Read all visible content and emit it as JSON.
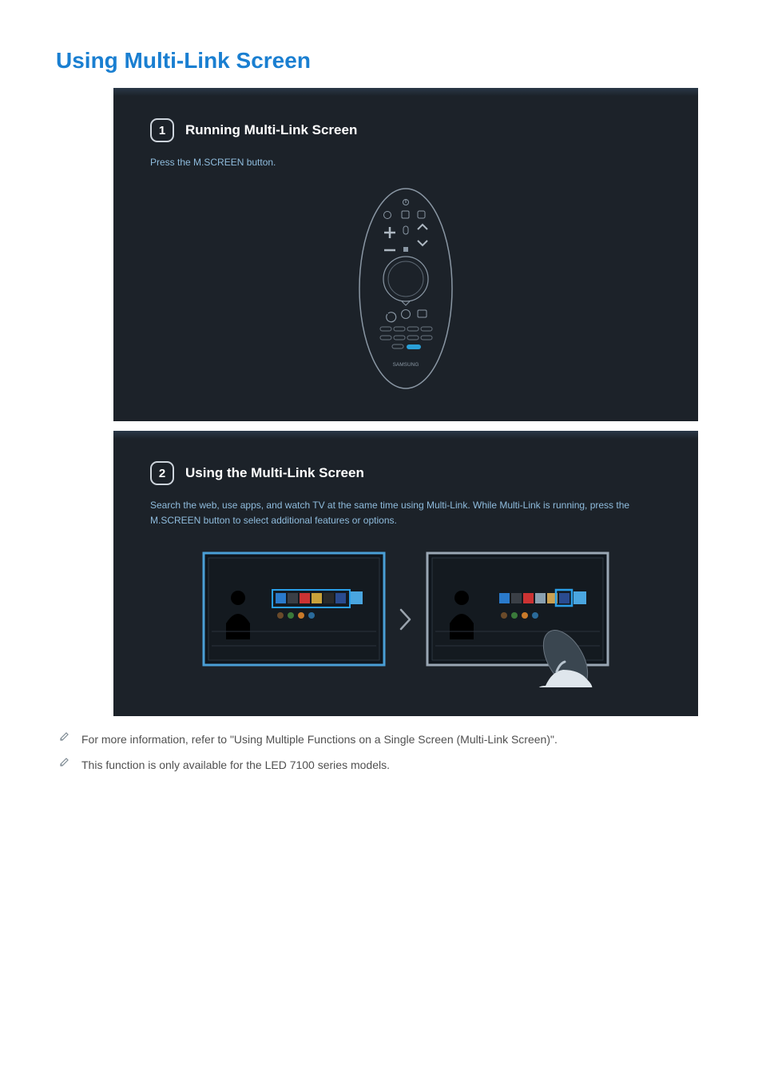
{
  "title": "Using Multi-Link Screen",
  "panel1": {
    "step_number": "1",
    "step_title": "Running Multi-Link Screen",
    "instruction": "Press the M.SCREEN button.",
    "remote_brand": "SAMSUNG"
  },
  "panel2": {
    "step_number": "2",
    "step_title": "Using the Multi-Link Screen",
    "instruction": "Search the web, use apps, and watch TV at the same time using Multi-Link. While Multi-Link is running, press the M.SCREEN button to select additional features or options."
  },
  "notes": {
    "n1": "For more information, refer to \"Using Multiple Functions on a Single Screen (Multi-Link Screen)\".",
    "n2": "This function is only available for the LED 7100 series models."
  }
}
